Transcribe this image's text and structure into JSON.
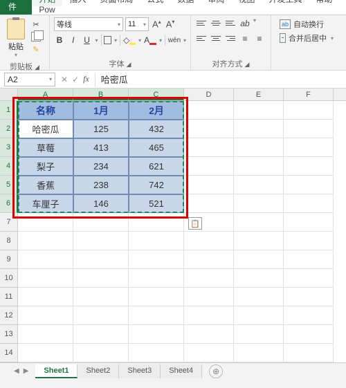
{
  "menu": {
    "file": "文件",
    "tabs": [
      "开始",
      "插入",
      "页面布局",
      "公式",
      "数据",
      "审阅",
      "视图",
      "开发工具",
      "帮助",
      "Pow"
    ]
  },
  "ribbon": {
    "clipboard": {
      "paste": "粘贴",
      "group": "剪贴板"
    },
    "font": {
      "name": "等线",
      "size": "11",
      "group": "字体"
    },
    "align": {
      "wrap": "自动换行",
      "merge": "合并后居中",
      "group": "对齐方式"
    }
  },
  "namebox": "A2",
  "formula": "哈密瓜",
  "columns": [
    "A",
    "B",
    "C",
    "D",
    "E",
    "F"
  ],
  "rows": [
    "1",
    "2",
    "3",
    "4",
    "5",
    "6",
    "7",
    "8",
    "9",
    "10",
    "11",
    "12",
    "13",
    "14"
  ],
  "chart_data": {
    "type": "table",
    "headers": [
      "名称",
      "1月",
      "2月"
    ],
    "rows": [
      [
        "哈密瓜",
        125,
        432
      ],
      [
        "草莓",
        413,
        465
      ],
      [
        "梨子",
        234,
        621
      ],
      [
        "香蕉",
        238,
        742
      ],
      [
        "车厘子",
        146,
        521
      ]
    ]
  },
  "sheets": [
    "Sheet1",
    "Sheet2",
    "Sheet3",
    "Sheet4"
  ],
  "active_sheet": 0
}
